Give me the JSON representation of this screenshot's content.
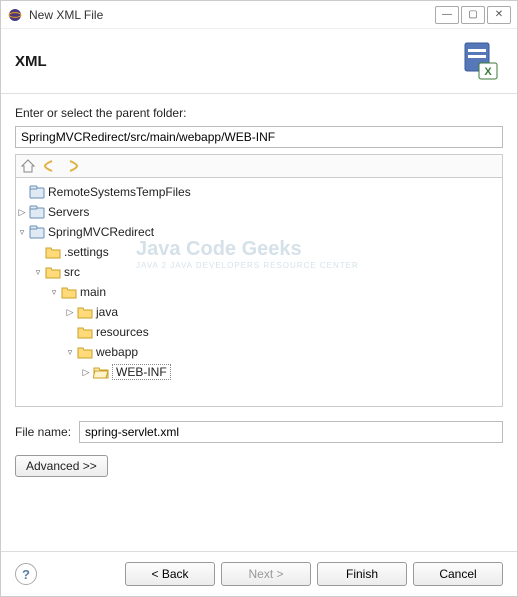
{
  "titlebar": {
    "text": "New XML File"
  },
  "header": {
    "title": "XML"
  },
  "prompt": "Enter or select the parent folder:",
  "path_value": "SpringMVCRedirect/src/main/webapp/WEB-INF",
  "tree": {
    "nodes": [
      {
        "depth": 0,
        "expander": "",
        "icon": "project",
        "label": "RemoteSystemsTempFiles",
        "selected": false
      },
      {
        "depth": 0,
        "expander": "▷",
        "icon": "project",
        "label": "Servers",
        "selected": false
      },
      {
        "depth": 0,
        "expander": "▿",
        "icon": "project",
        "label": "SpringMVCRedirect",
        "selected": false
      },
      {
        "depth": 1,
        "expander": "",
        "icon": "folder",
        "label": ".settings",
        "selected": false
      },
      {
        "depth": 1,
        "expander": "▿",
        "icon": "folder",
        "label": "src",
        "selected": false
      },
      {
        "depth": 2,
        "expander": "▿",
        "icon": "folder",
        "label": "main",
        "selected": false
      },
      {
        "depth": 3,
        "expander": "▷",
        "icon": "folder",
        "label": "java",
        "selected": false
      },
      {
        "depth": 3,
        "expander": "",
        "icon": "folder",
        "label": "resources",
        "selected": false
      },
      {
        "depth": 3,
        "expander": "▿",
        "icon": "folder",
        "label": "webapp",
        "selected": false
      },
      {
        "depth": 4,
        "expander": "▷",
        "icon": "folder-open",
        "label": "WEB-INF",
        "selected": true
      }
    ]
  },
  "file_label": "File name:",
  "file_value": "spring-servlet.xml",
  "advanced_label": "Advanced >>",
  "buttons": {
    "back": "< Back",
    "next": "Next >",
    "finish": "Finish",
    "cancel": "Cancel"
  },
  "watermark": {
    "main": "Java Code Geeks",
    "sub": "JAVA 2 JAVA DEVELOPERS RESOURCE CENTER"
  }
}
